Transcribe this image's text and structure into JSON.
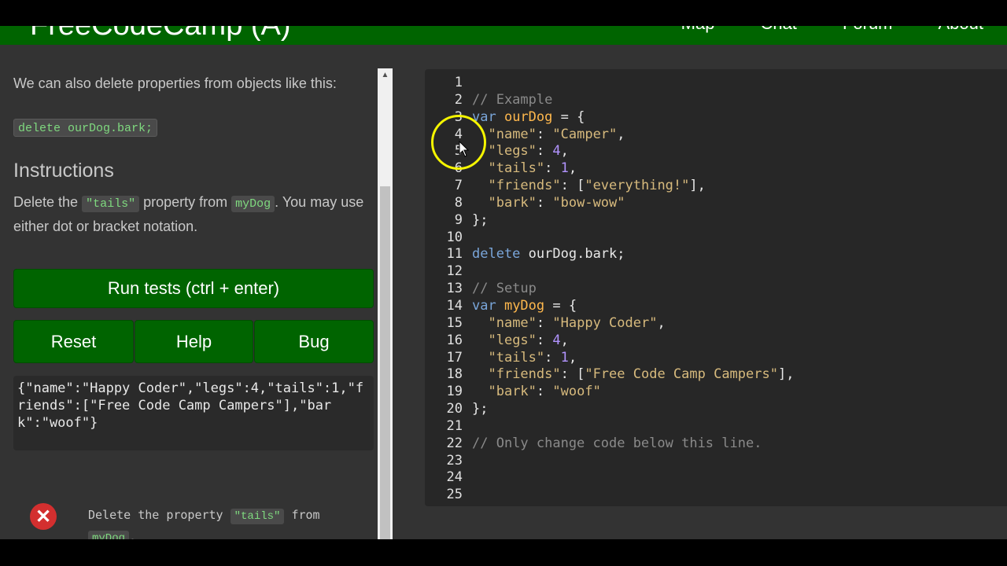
{
  "navbar": {
    "brand": "FreeCodeCamp (A)",
    "links": [
      "Map",
      "Chat",
      "Forum",
      "About"
    ]
  },
  "challenge": {
    "description": "We can also delete properties from objects like this:",
    "example_code": "delete ourDog.bark;",
    "instructions_heading": "Instructions",
    "instr_part1": "Delete the ",
    "instr_code1": "\"tails\"",
    "instr_part2": " property from ",
    "instr_code2": "myDog",
    "instr_part3": ". You may use either dot or bracket notation."
  },
  "buttons": {
    "run": "Run tests (ctrl + enter)",
    "reset": "Reset",
    "help": "Help",
    "bug": "Bug"
  },
  "output": "{\"name\":\"Happy Coder\",\"legs\":4,\"tails\":1,\"friends\":[\"Free Code Camp Campers\"],\"bark\":\"woof\"}",
  "tests": [
    {
      "status": "fail",
      "part1": "Delete the property ",
      "code1": "\"tails\"",
      "part2": " from ",
      "code2": "myDog",
      "part3": "."
    }
  ],
  "icons": {
    "fail": "close-icon",
    "scroll_up": "arrow-up-icon"
  },
  "colors": {
    "nav_green": "#006400",
    "button_green": "#006400",
    "fail_red": "#d32f2f",
    "highlight_ring": "#f5f500"
  },
  "editor": {
    "lines": [
      [],
      [
        [
          "comment",
          "// Example"
        ]
      ],
      [
        [
          "keyword",
          "var "
        ],
        [
          "def",
          "ourDog"
        ],
        [
          "plain",
          " = {"
        ]
      ],
      [
        [
          "plain",
          "  "
        ],
        [
          "string",
          "\"name\""
        ],
        [
          "plain",
          ": "
        ],
        [
          "string",
          "\"Camper\""
        ],
        [
          "plain",
          ","
        ]
      ],
      [
        [
          "plain",
          "  "
        ],
        [
          "string",
          "\"legs\""
        ],
        [
          "plain",
          ": "
        ],
        [
          "number",
          "4"
        ],
        [
          "plain",
          ","
        ]
      ],
      [
        [
          "plain",
          "  "
        ],
        [
          "string",
          "\"tails\""
        ],
        [
          "plain",
          ": "
        ],
        [
          "number",
          "1"
        ],
        [
          "plain",
          ","
        ]
      ],
      [
        [
          "plain",
          "  "
        ],
        [
          "string",
          "\"friends\""
        ],
        [
          "plain",
          ": ["
        ],
        [
          "string",
          "\"everything!\""
        ],
        [
          "plain",
          "],"
        ]
      ],
      [
        [
          "plain",
          "  "
        ],
        [
          "string",
          "\"bark\""
        ],
        [
          "plain",
          ": "
        ],
        [
          "string",
          "\"bow-wow\""
        ]
      ],
      [
        [
          "plain",
          "};"
        ]
      ],
      [],
      [
        [
          "keyword",
          "delete "
        ],
        [
          "var",
          "ourDog"
        ],
        [
          "plain",
          "."
        ],
        [
          "prop",
          "bark"
        ],
        [
          "plain",
          ";"
        ]
      ],
      [],
      [
        [
          "comment",
          "// Setup"
        ]
      ],
      [
        [
          "keyword",
          "var "
        ],
        [
          "def",
          "myDog"
        ],
        [
          "plain",
          " = {"
        ]
      ],
      [
        [
          "plain",
          "  "
        ],
        [
          "string",
          "\"name\""
        ],
        [
          "plain",
          ": "
        ],
        [
          "string",
          "\"Happy Coder\""
        ],
        [
          "plain",
          ","
        ]
      ],
      [
        [
          "plain",
          "  "
        ],
        [
          "string",
          "\"legs\""
        ],
        [
          "plain",
          ": "
        ],
        [
          "number",
          "4"
        ],
        [
          "plain",
          ","
        ]
      ],
      [
        [
          "plain",
          "  "
        ],
        [
          "string",
          "\"tails\""
        ],
        [
          "plain",
          ": "
        ],
        [
          "number",
          "1"
        ],
        [
          "plain",
          ","
        ]
      ],
      [
        [
          "plain",
          "  "
        ],
        [
          "string",
          "\"friends\""
        ],
        [
          "plain",
          ": ["
        ],
        [
          "string",
          "\"Free Code Camp Campers\""
        ],
        [
          "plain",
          "],"
        ]
      ],
      [
        [
          "plain",
          "  "
        ],
        [
          "string",
          "\"bark\""
        ],
        [
          "plain",
          ": "
        ],
        [
          "string",
          "\"woof\""
        ]
      ],
      [
        [
          "plain",
          "};"
        ]
      ],
      [],
      [
        [
          "comment",
          "// Only change code below this line."
        ]
      ],
      [],
      [],
      []
    ]
  }
}
